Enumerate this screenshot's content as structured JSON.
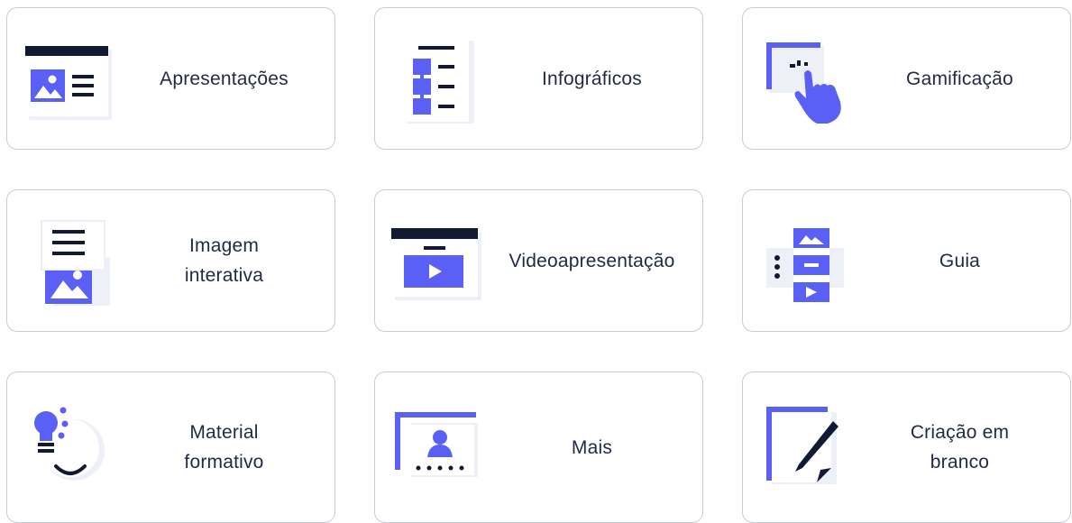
{
  "colors": {
    "accent": "#5a5ff5",
    "dark": "#121a33",
    "border": "#c9ccd3",
    "text": "#1f2a44"
  },
  "cards": [
    {
      "label": "Apresentações",
      "icon": "presentation-icon"
    },
    {
      "label": "Infográficos",
      "icon": "infographic-icon"
    },
    {
      "label": "Gamificação",
      "icon": "gamification-icon"
    },
    {
      "label": "Imagem\ninterativa",
      "icon": "interactive-image-icon"
    },
    {
      "label": "Videoapresentação",
      "icon": "video-presentation-icon"
    },
    {
      "label": "Guia",
      "icon": "guide-icon"
    },
    {
      "label": "Material\nformativo",
      "icon": "training-material-icon"
    },
    {
      "label": "Mais",
      "icon": "more-icon"
    },
    {
      "label": "Criação em\nbranco",
      "icon": "blank-creation-icon"
    }
  ]
}
